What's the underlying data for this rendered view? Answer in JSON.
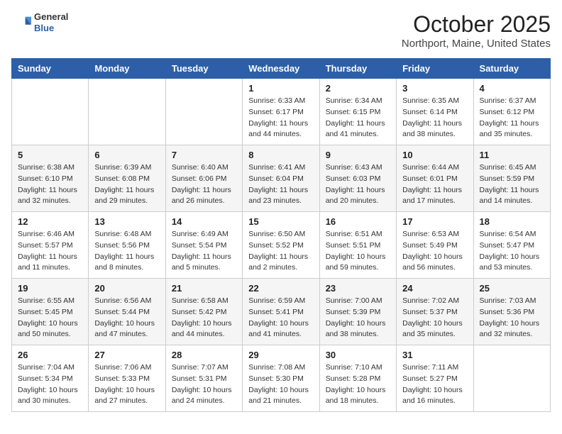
{
  "header": {
    "logo_general": "General",
    "logo_blue": "Blue",
    "month": "October 2025",
    "location": "Northport, Maine, United States"
  },
  "weekdays": [
    "Sunday",
    "Monday",
    "Tuesday",
    "Wednesday",
    "Thursday",
    "Friday",
    "Saturday"
  ],
  "rows": [
    [
      {
        "day": "",
        "info": ""
      },
      {
        "day": "",
        "info": ""
      },
      {
        "day": "",
        "info": ""
      },
      {
        "day": "1",
        "info": "Sunrise: 6:33 AM\nSunset: 6:17 PM\nDaylight: 11 hours\nand 44 minutes."
      },
      {
        "day": "2",
        "info": "Sunrise: 6:34 AM\nSunset: 6:15 PM\nDaylight: 11 hours\nand 41 minutes."
      },
      {
        "day": "3",
        "info": "Sunrise: 6:35 AM\nSunset: 6:14 PM\nDaylight: 11 hours\nand 38 minutes."
      },
      {
        "day": "4",
        "info": "Sunrise: 6:37 AM\nSunset: 6:12 PM\nDaylight: 11 hours\nand 35 minutes."
      }
    ],
    [
      {
        "day": "5",
        "info": "Sunrise: 6:38 AM\nSunset: 6:10 PM\nDaylight: 11 hours\nand 32 minutes."
      },
      {
        "day": "6",
        "info": "Sunrise: 6:39 AM\nSunset: 6:08 PM\nDaylight: 11 hours\nand 29 minutes."
      },
      {
        "day": "7",
        "info": "Sunrise: 6:40 AM\nSunset: 6:06 PM\nDaylight: 11 hours\nand 26 minutes."
      },
      {
        "day": "8",
        "info": "Sunrise: 6:41 AM\nSunset: 6:04 PM\nDaylight: 11 hours\nand 23 minutes."
      },
      {
        "day": "9",
        "info": "Sunrise: 6:43 AM\nSunset: 6:03 PM\nDaylight: 11 hours\nand 20 minutes."
      },
      {
        "day": "10",
        "info": "Sunrise: 6:44 AM\nSunset: 6:01 PM\nDaylight: 11 hours\nand 17 minutes."
      },
      {
        "day": "11",
        "info": "Sunrise: 6:45 AM\nSunset: 5:59 PM\nDaylight: 11 hours\nand 14 minutes."
      }
    ],
    [
      {
        "day": "12",
        "info": "Sunrise: 6:46 AM\nSunset: 5:57 PM\nDaylight: 11 hours\nand 11 minutes."
      },
      {
        "day": "13",
        "info": "Sunrise: 6:48 AM\nSunset: 5:56 PM\nDaylight: 11 hours\nand 8 minutes."
      },
      {
        "day": "14",
        "info": "Sunrise: 6:49 AM\nSunset: 5:54 PM\nDaylight: 11 hours\nand 5 minutes."
      },
      {
        "day": "15",
        "info": "Sunrise: 6:50 AM\nSunset: 5:52 PM\nDaylight: 11 hours\nand 2 minutes."
      },
      {
        "day": "16",
        "info": "Sunrise: 6:51 AM\nSunset: 5:51 PM\nDaylight: 10 hours\nand 59 minutes."
      },
      {
        "day": "17",
        "info": "Sunrise: 6:53 AM\nSunset: 5:49 PM\nDaylight: 10 hours\nand 56 minutes."
      },
      {
        "day": "18",
        "info": "Sunrise: 6:54 AM\nSunset: 5:47 PM\nDaylight: 10 hours\nand 53 minutes."
      }
    ],
    [
      {
        "day": "19",
        "info": "Sunrise: 6:55 AM\nSunset: 5:45 PM\nDaylight: 10 hours\nand 50 minutes."
      },
      {
        "day": "20",
        "info": "Sunrise: 6:56 AM\nSunset: 5:44 PM\nDaylight: 10 hours\nand 47 minutes."
      },
      {
        "day": "21",
        "info": "Sunrise: 6:58 AM\nSunset: 5:42 PM\nDaylight: 10 hours\nand 44 minutes."
      },
      {
        "day": "22",
        "info": "Sunrise: 6:59 AM\nSunset: 5:41 PM\nDaylight: 10 hours\nand 41 minutes."
      },
      {
        "day": "23",
        "info": "Sunrise: 7:00 AM\nSunset: 5:39 PM\nDaylight: 10 hours\nand 38 minutes."
      },
      {
        "day": "24",
        "info": "Sunrise: 7:02 AM\nSunset: 5:37 PM\nDaylight: 10 hours\nand 35 minutes."
      },
      {
        "day": "25",
        "info": "Sunrise: 7:03 AM\nSunset: 5:36 PM\nDaylight: 10 hours\nand 32 minutes."
      }
    ],
    [
      {
        "day": "26",
        "info": "Sunrise: 7:04 AM\nSunset: 5:34 PM\nDaylight: 10 hours\nand 30 minutes."
      },
      {
        "day": "27",
        "info": "Sunrise: 7:06 AM\nSunset: 5:33 PM\nDaylight: 10 hours\nand 27 minutes."
      },
      {
        "day": "28",
        "info": "Sunrise: 7:07 AM\nSunset: 5:31 PM\nDaylight: 10 hours\nand 24 minutes."
      },
      {
        "day": "29",
        "info": "Sunrise: 7:08 AM\nSunset: 5:30 PM\nDaylight: 10 hours\nand 21 minutes."
      },
      {
        "day": "30",
        "info": "Sunrise: 7:10 AM\nSunset: 5:28 PM\nDaylight: 10 hours\nand 18 minutes."
      },
      {
        "day": "31",
        "info": "Sunrise: 7:11 AM\nSunset: 5:27 PM\nDaylight: 10 hours\nand 16 minutes."
      },
      {
        "day": "",
        "info": ""
      }
    ]
  ]
}
